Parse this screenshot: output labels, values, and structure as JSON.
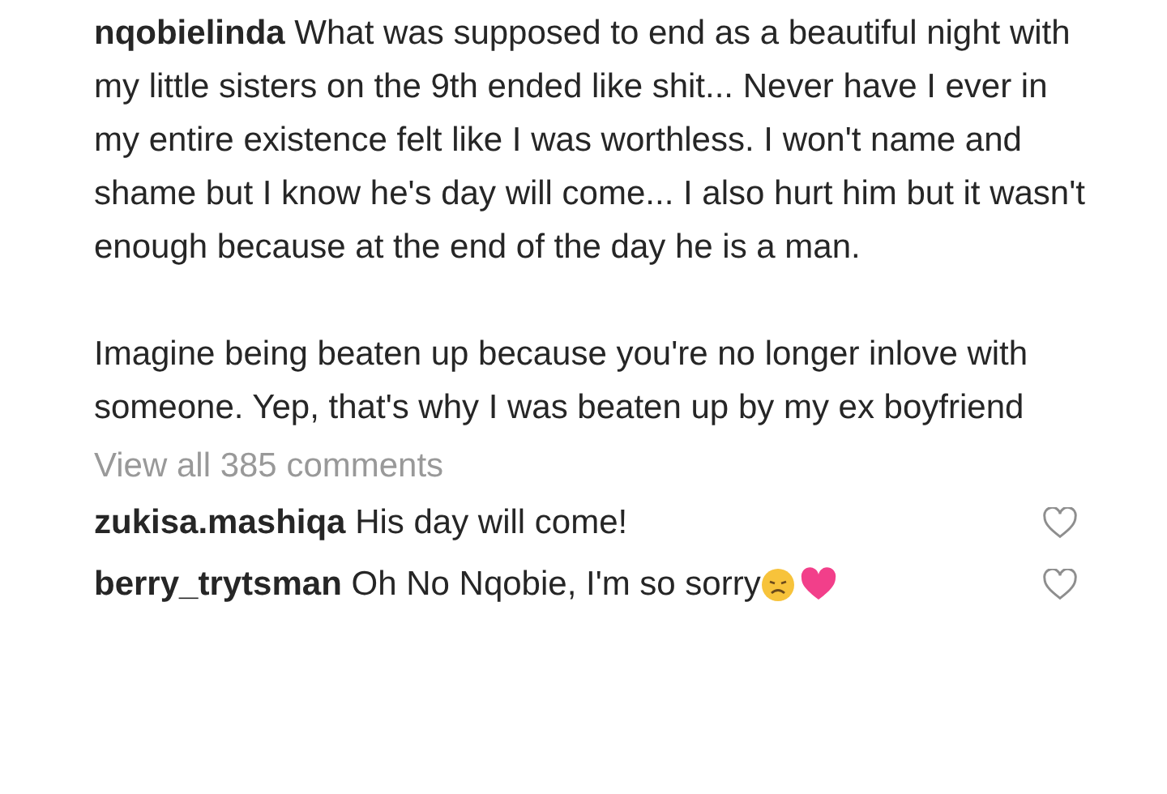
{
  "caption": {
    "username": "nqobielinda",
    "paragraphs": [
      "What was supposed to end as a beautiful night with my little sisters on the 9th ended like shit... Never have I ever in my entire existence felt like I was worthless. I won't name and shame but I know he's day will come... I also hurt him but it wasn't enough because at the end of the day he is a man.",
      "Imagine being beaten up because you're no longer inlove with someone. Yep, that's why I was beaten up by my ex boyfriend"
    ]
  },
  "view_all": "View all 385 comments",
  "comments": [
    {
      "username": "zukisa.mashiqa",
      "text": "His day will come!",
      "liked": false
    },
    {
      "username": "berry_trytsman",
      "text": "Oh No Nqobie, I'm so sorry",
      "liked": false
    }
  ]
}
